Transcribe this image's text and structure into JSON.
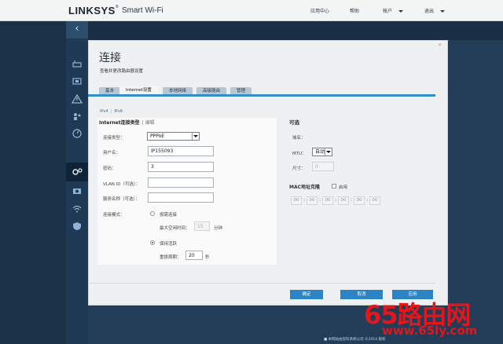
{
  "header": {
    "brand": "LINKSYS",
    "brand_mark": "®",
    "product": "Smart Wi-Fi",
    "links": [
      "应用中心",
      "帮助",
      "帐户",
      "退出"
    ]
  },
  "sidebar": {
    "collapse_glyph": "‹",
    "icons": [
      "router-icon",
      "devices-icon",
      "warning-icon",
      "parental-icon",
      "speed-icon",
      "connectivity-icon",
      "camera-icon",
      "wifi-icon",
      "security-icon"
    ]
  },
  "dialog": {
    "title": "连接",
    "subtitle": "查看并更改路由器设置",
    "close": "×",
    "tabs": [
      "基本",
      "Internet设置",
      "本地网络",
      "高级路由",
      "管理"
    ],
    "active_tab": 1,
    "protocols": [
      "IPv4",
      "IPv6"
    ],
    "internet": {
      "heading": "Internet连接类型",
      "edit": "编辑",
      "type_label": "连接类型：",
      "type_value": "PPPoE",
      "username_label": "用户名：",
      "username_value": "IP155093",
      "password_label": "密码：",
      "password_value": "3",
      "vlan_label": "VLAN ID（可选）：",
      "vlan_value": "",
      "service_label": "服务名称（可选）：",
      "service_value": "",
      "mode_label": "连接模式：",
      "on_demand_label": "按需连接",
      "max_idle_label": "最大空闲时间：",
      "max_idle_value": "15",
      "minutes_unit": "分钟",
      "keep_alive_label": "保持活跃",
      "redial_label": "重拨周期：",
      "redial_value": "20",
      "seconds_unit": "秒",
      "selected_mode": "keep_alive"
    },
    "optional": {
      "heading": "可选",
      "domain_label": "域名：",
      "mtu_label": "MTU：",
      "mtu_value": "自动",
      "size_label": "尺寸：",
      "size_value": "0",
      "mac_heading": "MAC地址克隆",
      "mac_enable_label": "启用",
      "mac_octets": [
        "00",
        "00",
        "00",
        "00",
        "00",
        "00"
      ]
    },
    "buttons": {
      "ok": "确定",
      "cancel": "取消",
      "apply": "应用"
    }
  },
  "bottom_text": "■ 本网站由思科系统公司 ©2014   版权",
  "watermark": {
    "main": "65路由网",
    "url": "www.65ly.com"
  },
  "colors": {
    "accent": "#2c84c4",
    "page_bg": "#1b3148",
    "watermark": "#e0171d"
  }
}
